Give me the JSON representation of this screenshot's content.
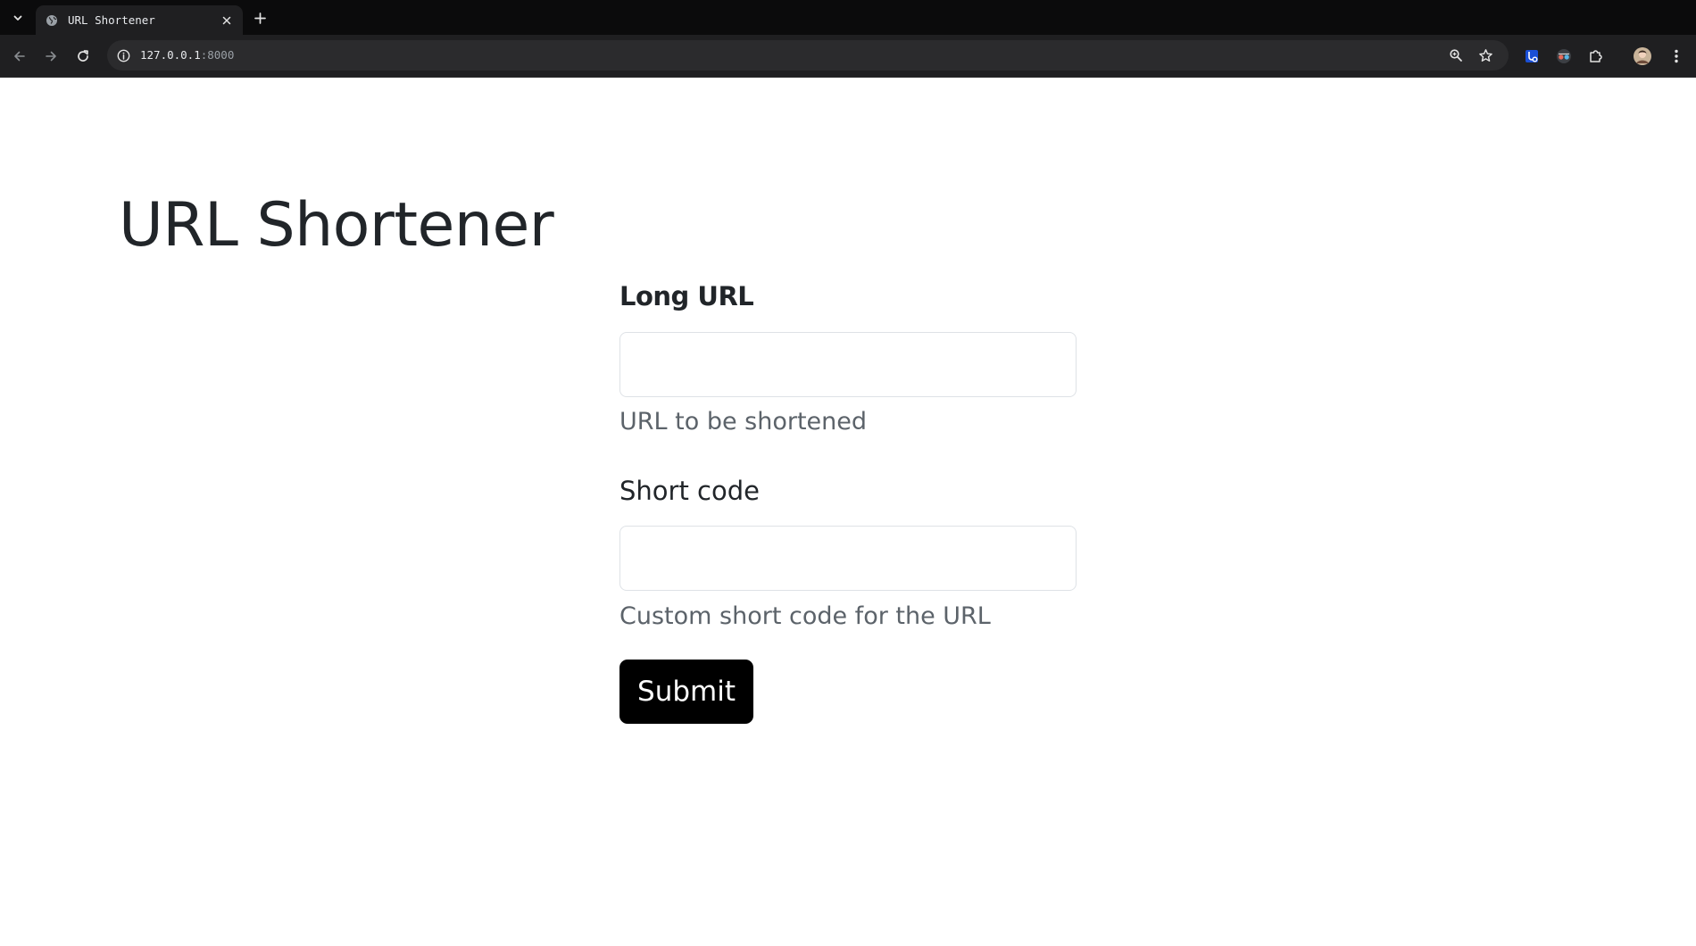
{
  "browser": {
    "tab": {
      "title": "URL Shortener",
      "favicon_icon": "globe-icon"
    },
    "address": {
      "host": "127.0.0.1",
      "port": ":8000"
    },
    "icons": {
      "tab_list": "chevron-down-icon",
      "tab_close": "close-icon",
      "new_tab": "plus-icon",
      "back": "arrow-left-icon",
      "forward": "arrow-right-icon",
      "reload": "reload-icon",
      "site_info": "info-icon",
      "zoom": "zoom-icon",
      "bookmark": "star-icon",
      "extension_1": "shield-extension-icon",
      "extension_2": "eyes-extension-icon",
      "extensions": "puzzle-icon",
      "profile": "avatar",
      "menu": "kebab-menu-icon"
    }
  },
  "page": {
    "title": "URL Shortener",
    "form": {
      "long_url": {
        "label": "Long URL",
        "value": "",
        "help": "URL to be shortened"
      },
      "short_code": {
        "label": "Short code",
        "value": "",
        "help": "Custom short code for the URL"
      },
      "submit_label": "Submit"
    }
  },
  "colors": {
    "chrome_bg": "#0b0b0c",
    "toolbar_bg": "#1f1f21",
    "text_primary": "#212529",
    "text_muted": "#5c636a",
    "button_bg": "#000000",
    "input_border": "#dee2e6"
  }
}
